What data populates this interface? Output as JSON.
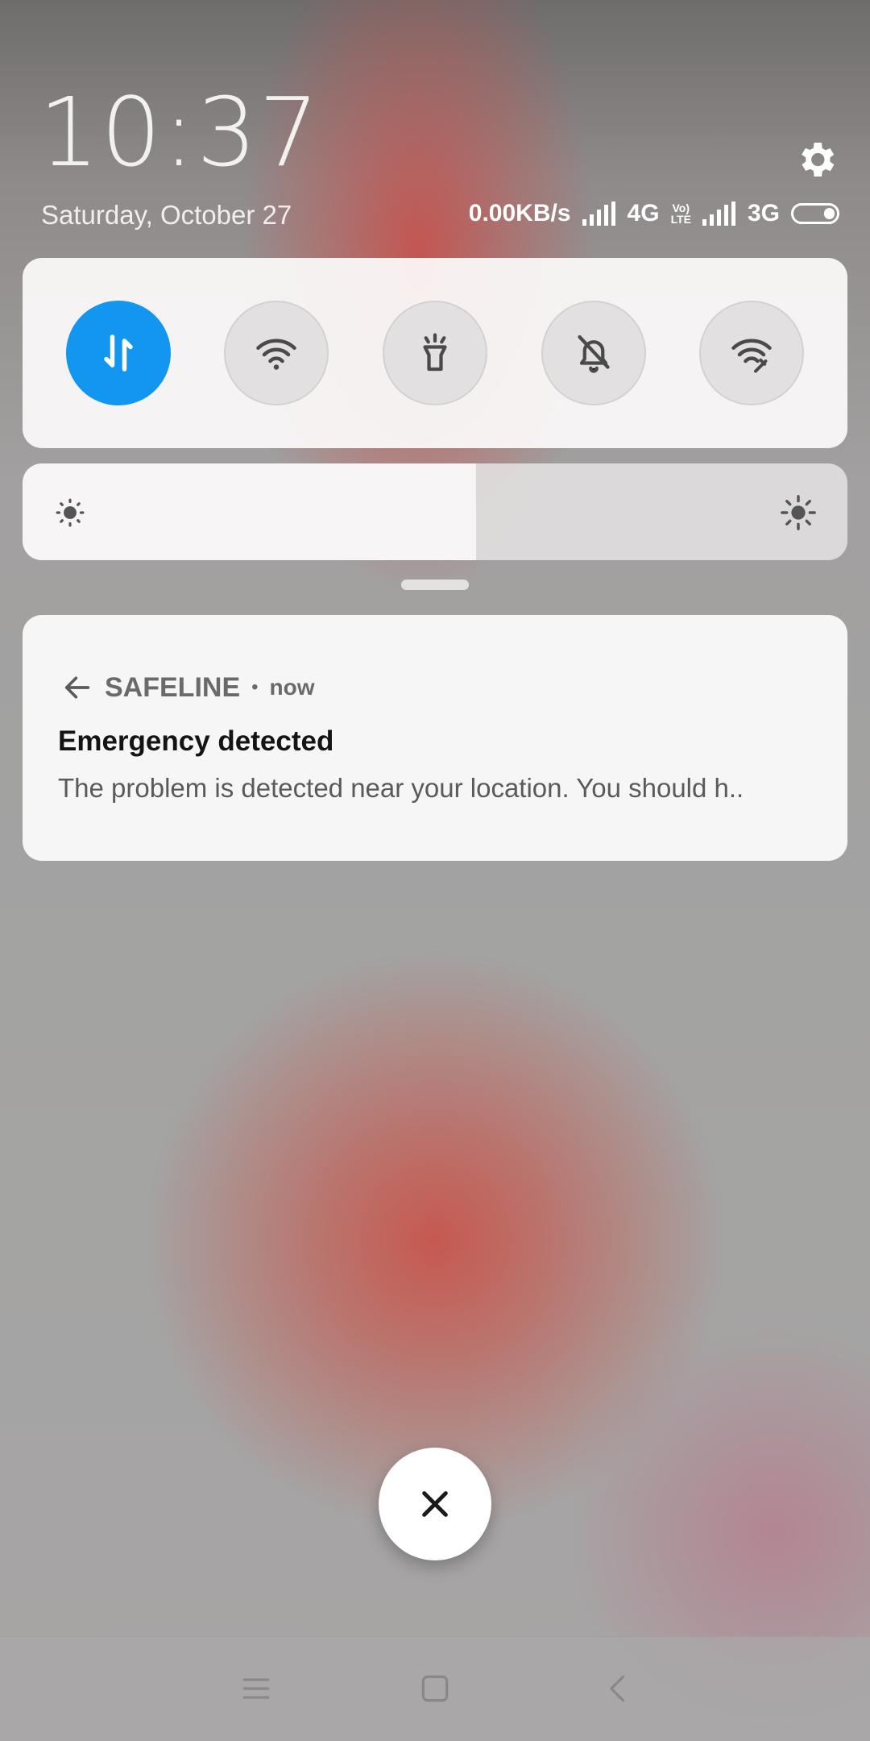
{
  "header": {
    "time": "10:37",
    "date": "Saturday, October 27"
  },
  "status_bar": {
    "net_speed": "0.00KB/s",
    "network1": "4G",
    "volte_top": "Vo)",
    "volte_bottom": "LTE",
    "network2": "3G",
    "icons": [
      "signal-icon",
      "signal-icon",
      "battery-icon"
    ]
  },
  "quick_toggles": [
    {
      "name": "mobile-data",
      "icon": "data-arrows-icon",
      "active": true
    },
    {
      "name": "wifi",
      "icon": "wifi-icon",
      "active": false
    },
    {
      "name": "flashlight",
      "icon": "flashlight-icon",
      "active": false
    },
    {
      "name": "silent",
      "icon": "bell-off-icon",
      "active": false
    },
    {
      "name": "hotspot",
      "icon": "hotspot-icon",
      "active": false
    }
  ],
  "brightness": {
    "level": 0.55
  },
  "notification": {
    "app_name": "SAFELINE",
    "separator": "•",
    "time": "now",
    "title": "Emergency detected",
    "body": "The problem is detected near your location. You should h.."
  },
  "colors": {
    "accent": "#1296f0",
    "panel": "#f7f6f6",
    "title_text": "#141414",
    "body_text": "#5a5a5a"
  },
  "navigation": {
    "buttons": [
      "menu-icon",
      "home-icon",
      "back-icon"
    ]
  }
}
